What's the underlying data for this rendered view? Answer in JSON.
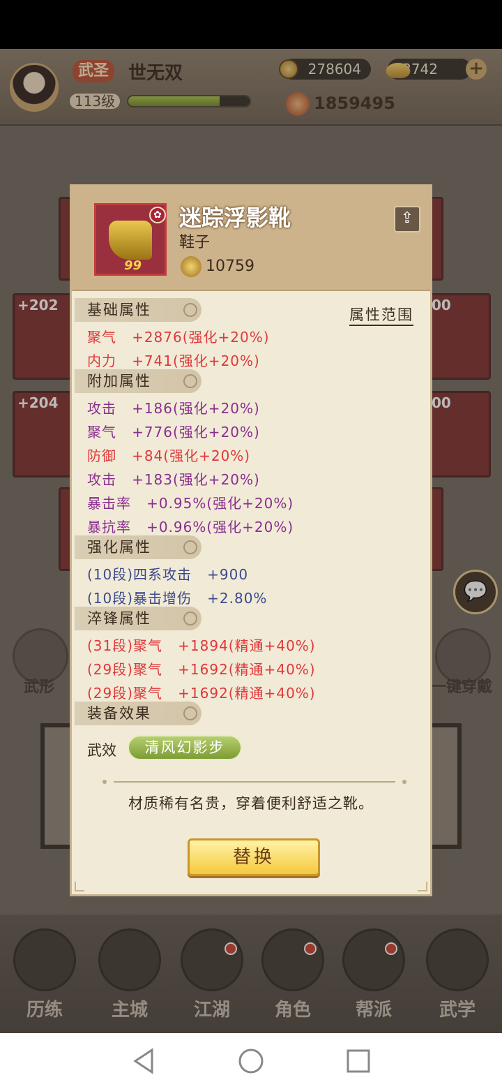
{
  "header": {
    "rank_badge": "武圣",
    "player_name": "世无双",
    "level": "113级",
    "xp_fraction": 0.75,
    "copper": "278604",
    "gold": "3742",
    "combat_power": "1859495"
  },
  "background_slots": {
    "left_top_plus": "+202",
    "left_mid_plus": "+204",
    "right_top_plus": "00",
    "right_mid_plus": "00",
    "nn": "99"
  },
  "side_buttons": {
    "left_label": "武形",
    "right_label": "一键穿戴"
  },
  "bottom_nav": [
    "历练",
    "主城",
    "江湖",
    "角色",
    "帮派",
    "武学"
  ],
  "popup": {
    "item_name": "迷踪浮影靴",
    "item_type": "鞋子",
    "item_power": "10759",
    "item_badge": "99",
    "attr_range_label": "属性范围",
    "sections": {
      "base": "基础属性",
      "extra": "附加属性",
      "enhance": "强化属性",
      "temper": "淬锋属性",
      "effect": "装备效果"
    },
    "base_rows": [
      {
        "name": "聚气",
        "value": "+2876(强化+20%)"
      },
      {
        "name": "内力",
        "value": "+741(强化+20%)"
      }
    ],
    "extra_rows": [
      {
        "name": "攻击",
        "value": "+186(强化+20%)"
      },
      {
        "name": "聚气",
        "value": "+776(强化+20%)"
      },
      {
        "name": "防御",
        "value": "+84(强化+20%)"
      },
      {
        "name": "攻击",
        "value": "+183(强化+20%)"
      },
      {
        "name": "暴击率",
        "value": "+0.95%(强化+20%)"
      },
      {
        "name": "暴抗率",
        "value": "+0.96%(强化+20%)"
      }
    ],
    "enhance_rows": [
      {
        "name": "(10段)四系攻击",
        "value": "+900"
      },
      {
        "name": "(10段)暴击增伤",
        "value": "+2.80%"
      }
    ],
    "temper_rows": [
      {
        "name": "(31段)聚气",
        "value": "+1894(精通+40%)"
      },
      {
        "name": "(29段)聚气",
        "value": "+1692(精通+40%)"
      },
      {
        "name": "(29段)聚气",
        "value": "+1692(精通+40%)"
      }
    ],
    "effect_label": "武效",
    "effect_name": "清风幻影步",
    "description": "材质稀有名贵，穿着便利舒适之靴。",
    "replace_button": "替换"
  }
}
